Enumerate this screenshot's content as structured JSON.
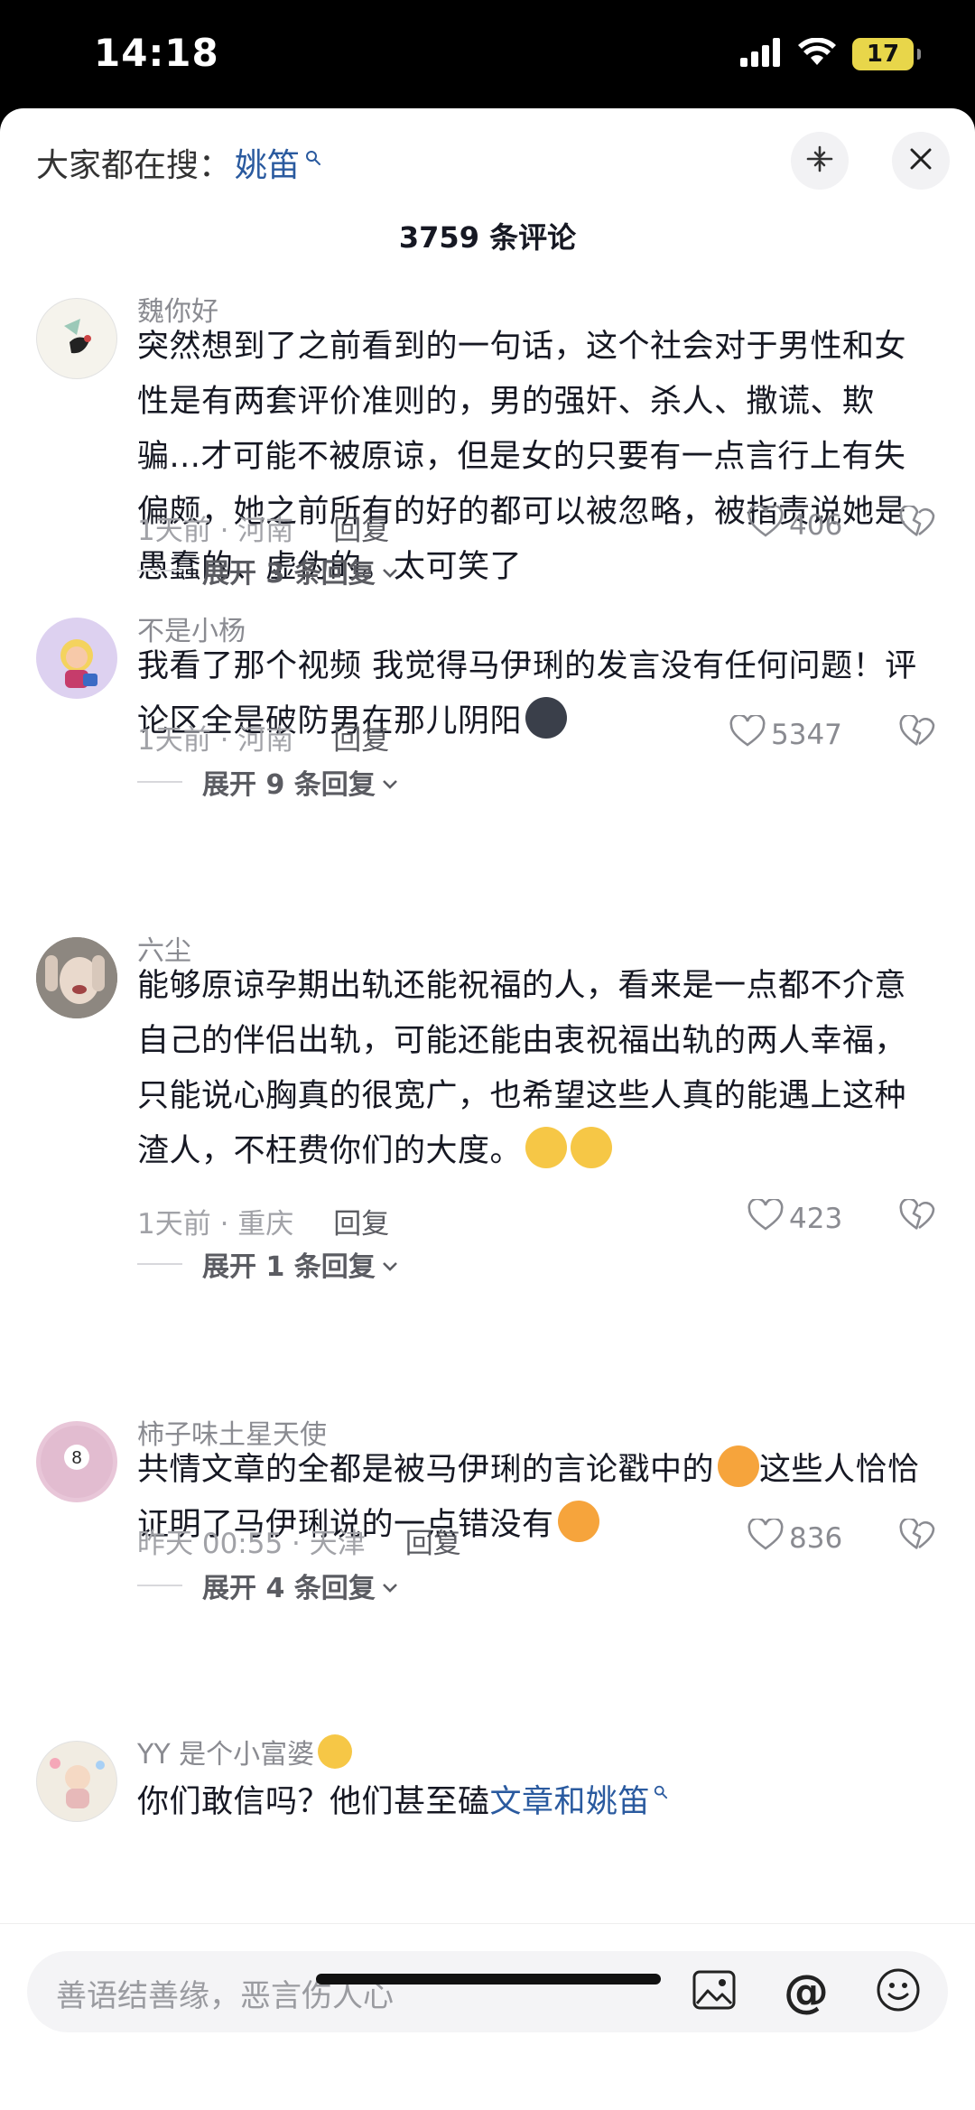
{
  "status_bar": {
    "time": "14:18",
    "battery": "17"
  },
  "header": {
    "search_prefix": "大家都在搜：",
    "search_keyword": "姚笛",
    "comment_count": "3759 条评论"
  },
  "comments": [
    {
      "username": "魏你好",
      "text": "突然想到了之前看到的一句话，这个社会对于男性和女性是有两套评价准则的，男的强奸、杀人、撒谎、欺骗...才可能不被原谅，但是女的只要有一点言行上有失偏颇，她之前所有的好的都可以被忽略，被指责说她是愚蠢的、虚伪的。太可笑了",
      "time_location": "1天前 · 河南",
      "reply_label": "回复",
      "likes": "406",
      "expand_label": "展开 3 条回复"
    },
    {
      "username": "不是小杨",
      "text": "我看了那个视频 我觉得马伊琍的发言没有任何问题！评论区全是破防男在那儿阴阳",
      "time_location": "1天前 · 河南",
      "reply_label": "回复",
      "likes": "5347",
      "expand_label": "展开 9 条回复"
    },
    {
      "username": "六尘",
      "text": "能够原谅孕期出轨还能祝福的人，看来是一点都不介意自己的伴侣出轨，可能还能由衷祝福出轨的两人幸福，只能说心胸真的很宽广，也希望这些人真的能遇上这种渣人，不枉费你们的大度。",
      "time_location": "1天前 · 重庆",
      "reply_label": "回复",
      "likes": "423",
      "expand_label": "展开 1 条回复"
    },
    {
      "username": "柿子味土星天使",
      "text": "共情文章的全都是被马伊琍的言论戳中的",
      "text2": "这些人恰恰证明了马伊琍说的一点错没有",
      "time_location": "昨天 00:55 · 天津",
      "reply_label": "回复",
      "likes": "836",
      "expand_label": "展开 4 条回复"
    },
    {
      "username": "YY 是个小富婆",
      "text": "你们敢信吗？他们甚至磕",
      "link_text": "文章和姚笛"
    }
  ],
  "input_bar": {
    "placeholder": "善语结善缘，恶言伤人心"
  },
  "colors": {
    "link": "#2a5a9f",
    "background": "#ffffff",
    "meta": "#a1a2a7"
  }
}
